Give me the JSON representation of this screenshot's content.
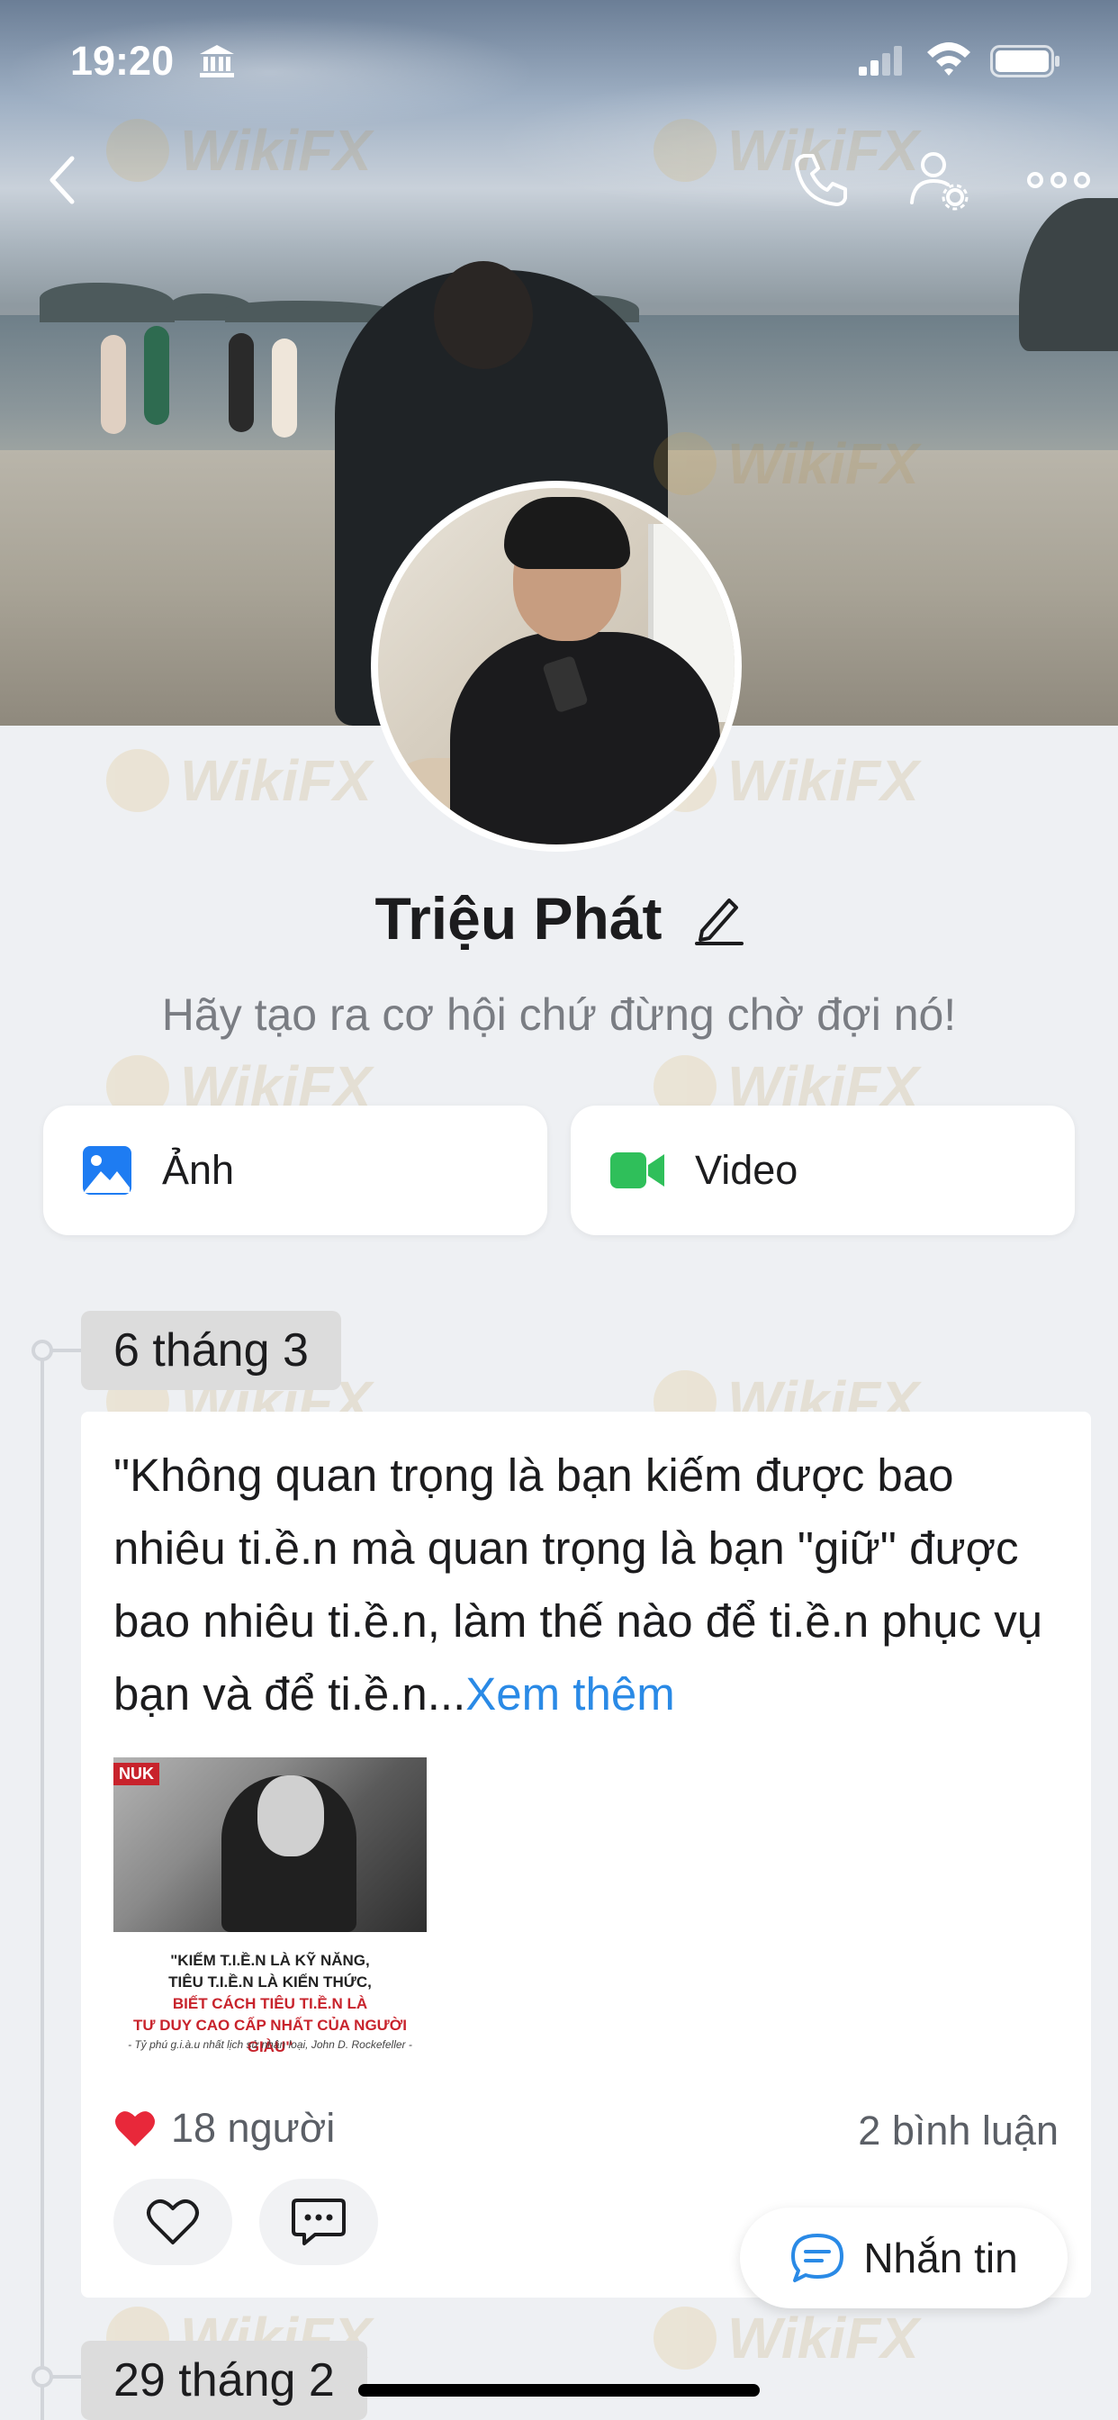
{
  "status_bar": {
    "time": "19:20"
  },
  "profile": {
    "name": "Triệu Phát",
    "bio": "Hãy tạo ra cơ hội chứ đừng chờ đợi nó!"
  },
  "media_buttons": [
    {
      "label": "Ảnh",
      "icon": "photo-icon",
      "color": "#1e7cf2"
    },
    {
      "label": "Video",
      "icon": "video-camera-icon",
      "color": "#2fbf5a"
    }
  ],
  "timeline": {
    "dates": [
      "6 tháng 3",
      "29 tháng 2"
    ],
    "post": {
      "text": "\"Không quan trọng là bạn kiếm được bao nhiêu ti.ề.n mà quan trọng là bạn \"giữ\" được bao nhiêu ti.ề.n, làm thế nào để ti.ề.n phục vụ bạn và để ti.ề.n...",
      "see_more": "Xem thêm",
      "image": {
        "tag": "NUK",
        "caption_line1": "\"KIẾM T.I.Ề.N LÀ KỸ NĂNG,",
        "caption_line2": "TIÊU T.I.Ề.N LÀ KIẾN THỨC,",
        "caption_line3": "BIẾT CÁCH TIÊU TI.Ề.N LÀ",
        "caption_line4": "TƯ DUY CAO CẤP NHẤT CỦA NGƯỜI GIÀU\"",
        "credit": "- Tỷ phú g.i.à.u nhất lịch sử nhân loại, John D. Rockefeller -"
      },
      "likes": "18 người",
      "comments": "2 bình luận"
    }
  },
  "floating_button": {
    "label": "Nhắn tin"
  },
  "watermark": "WikiFX",
  "colors": {
    "accent": "#2a8ae6",
    "heart": "#e8283a",
    "background": "#eef0f3"
  }
}
